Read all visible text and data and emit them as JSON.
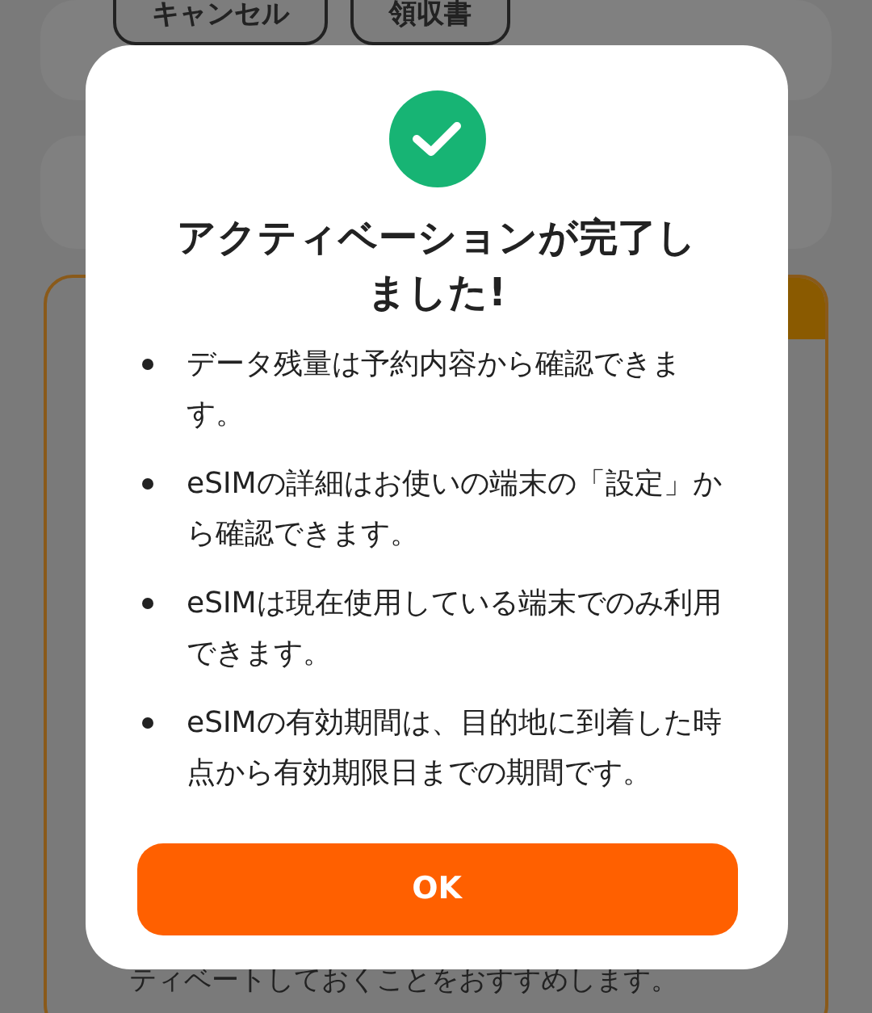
{
  "background": {
    "buttons": [
      "キャンセル",
      "領収書"
    ],
    "footer_text": "ティベートしておくことをおすすめします。"
  },
  "dialog": {
    "title": "アクティベーションが完了しました!",
    "items": [
      "データ残量は予約内容から確認できます。",
      "eSIMの詳細はお使いの端末の「設定」から確認できます。",
      "eSIMは現在使用している端末でのみ利用できます。",
      "eSIMの有効期間は、目的地に到着した時点から有効期限日までの期間です。"
    ],
    "button": "OK"
  }
}
